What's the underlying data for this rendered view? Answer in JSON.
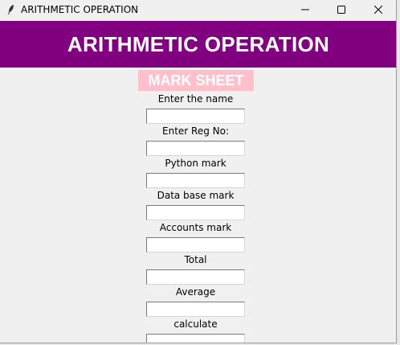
{
  "window": {
    "title": "ARITHMETIC OPERATION",
    "icon": "feather-icon",
    "controls": [
      "minimize-icon",
      "maximize-icon",
      "close-icon"
    ]
  },
  "header": {
    "title": "ARITHMETIC OPERATION",
    "background": "#800080",
    "color": "#ffffff"
  },
  "subtitle": {
    "text": "MARK SHEET",
    "background": "#ffc0cb",
    "color": "#ffffff"
  },
  "form": {
    "fields": [
      {
        "label": "Enter the name",
        "value": ""
      },
      {
        "label": "Enter Reg No:",
        "value": ""
      },
      {
        "label": "Python mark",
        "value": ""
      },
      {
        "label": "Data base mark",
        "value": ""
      },
      {
        "label": "Accounts mark",
        "value": ""
      },
      {
        "label": "Total",
        "value": ""
      },
      {
        "label": "Average",
        "value": ""
      },
      {
        "label": "calculate",
        "value": ""
      }
    ]
  }
}
